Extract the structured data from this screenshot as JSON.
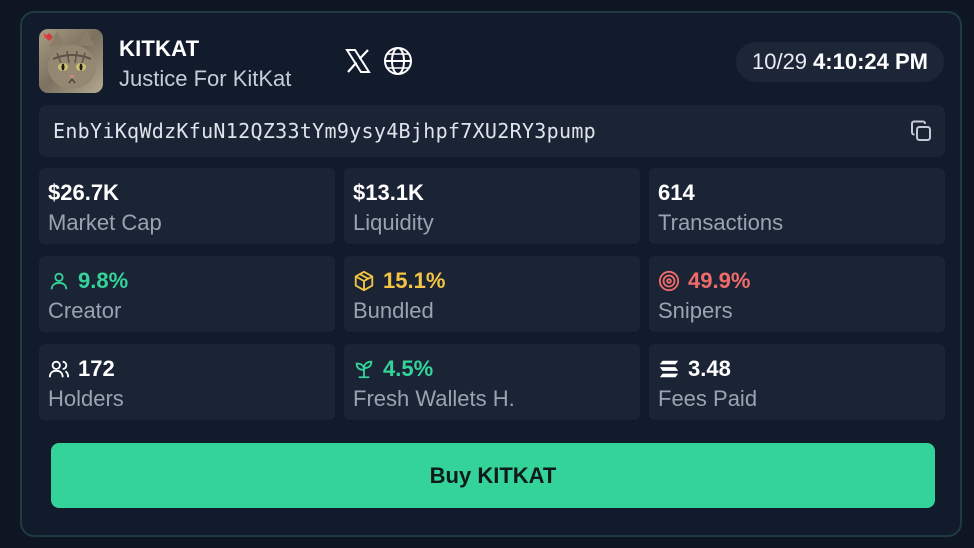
{
  "token": {
    "symbol": "KITKAT",
    "name": "Justice For KitKat",
    "address": "EnbYiKqWdzKfuN12QZ33tYm9ysy4Bjhpf7XU2RY3pump"
  },
  "clock": {
    "date": "10/29",
    "time": "4:10:24 PM"
  },
  "socials": [
    {
      "icon": "x-logo-icon"
    },
    {
      "icon": "globe-icon"
    }
  ],
  "stats": {
    "market_cap": {
      "value": "$26.7K",
      "label": "Market Cap"
    },
    "liquidity": {
      "value": "$13.1K",
      "label": "Liquidity"
    },
    "transactions": {
      "value": "614",
      "label": "Transactions"
    },
    "creator": {
      "value": "9.8%",
      "label": "Creator",
      "icon": "user-icon",
      "color": "#34d399"
    },
    "bundled": {
      "value": "15.1%",
      "label": "Bundled",
      "icon": "box-icon",
      "color": "#f4c542"
    },
    "snipers": {
      "value": "49.9%",
      "label": "Snipers",
      "icon": "target-icon",
      "color": "#f06b6b"
    },
    "holders": {
      "value": "172",
      "label": "Holders",
      "icon": "users-icon"
    },
    "fresh_wallets": {
      "value": "4.5%",
      "label": "Fresh Wallets H.",
      "icon": "sprout-icon",
      "color": "#34d399"
    },
    "fees_paid": {
      "value": "3.48",
      "label": "Fees Paid",
      "icon": "solana-icon"
    }
  },
  "buy_button": {
    "label": "Buy KITKAT",
    "color": "#34d399"
  },
  "colors": {
    "background": "#0e1523",
    "card": "#121b2b",
    "tile": "#1b2434",
    "accent": "#34d399"
  }
}
